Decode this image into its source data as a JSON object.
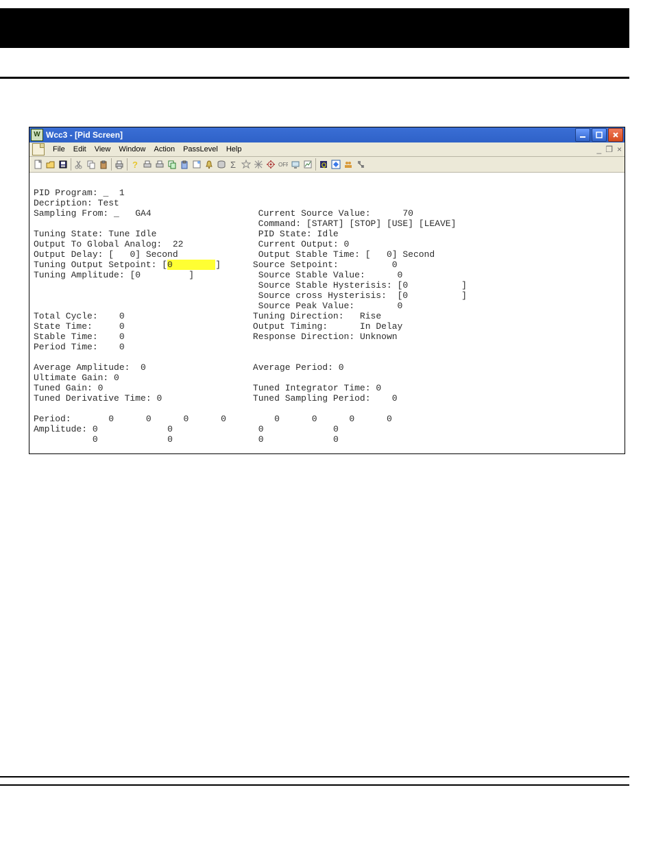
{
  "window": {
    "app_icon_text": "W",
    "title": "Wcc3 - [Pid Screen]"
  },
  "menu": {
    "items": [
      "File",
      "Edit",
      "View",
      "Window",
      "Action",
      "PassLevel",
      "Help"
    ]
  },
  "left": {
    "pid_program_label": "PID Program:",
    "pid_program_value": "_  1",
    "description_label": "Decription:",
    "description_value": "Test",
    "sampling_from_label": "Sampling From:",
    "sampling_from_value": "_   GA4",
    "tuning_state_label": "Tuning State:",
    "tuning_state_value": "Tune Idle",
    "output_global_label": "Output To Global Analog:",
    "output_global_value": "22",
    "output_delay_label": "Output Delay:",
    "output_delay_value": "[   0] Second",
    "tuning_output_setpoint_label": "Tuning Output Setpoint:",
    "tuning_output_setpoint_value": "0",
    "tuning_amplitude_label": "Tuning Amplitude:",
    "tuning_amplitude_value": "[0         ]",
    "total_cycle_label": "Total Cycle:",
    "total_cycle_value": "0",
    "state_time_label": "State Time:",
    "state_time_value": "0",
    "stable_time_label": "Stable Time:",
    "stable_time_value": "0",
    "period_time_label": "Period Time:",
    "period_time_value": "0",
    "avg_amplitude_label": "Average Amplitude:",
    "avg_amplitude_value": "0",
    "ultimate_gain_label": "Ultimate Gain:",
    "ultimate_gain_value": "0",
    "tuned_gain_label": "Tuned Gain:",
    "tuned_gain_value": "0",
    "tuned_derivative_label": "Tuned Derivative Time:",
    "tuned_derivative_value": "0",
    "period_row_label": "Period:",
    "period_row": [
      "0",
      "0",
      "0",
      "0"
    ],
    "amplitude_row_label": "Amplitude:",
    "amplitude_row1": [
      "0",
      "0"
    ],
    "amplitude_row2": [
      "0",
      "0"
    ]
  },
  "right": {
    "current_source_label": "Current Source Value:",
    "current_source_value": "70",
    "command_label": "Command:",
    "command_buttons": [
      "[START]",
      "[STOP]",
      "[USE]",
      "[LEAVE]"
    ],
    "pid_state_label": "PID State:",
    "pid_state_value": "Idle",
    "current_output_label": "Current Output:",
    "current_output_value": "0",
    "output_stable_time_label": "Output Stable Time:",
    "output_stable_time_value": "[   0] Second",
    "source_setpoint_label": "Source Setpoint:",
    "source_setpoint_value": "0",
    "source_stable_value_label": "Source Stable Value:",
    "source_stable_value": "0",
    "source_stable_hyst_label": "Source Stable Hysterisis:",
    "source_stable_hyst_value": "[0          ]",
    "source_cross_hyst_label": "Source cross Hysterisis:",
    "source_cross_hyst_value": "[0          ]",
    "source_peak_label": "Source Peak Value:",
    "source_peak_value": "0",
    "tuning_direction_label": "Tuning Direction:",
    "tuning_direction_value": "Rise",
    "output_timing_label": "Output Timing:",
    "output_timing_value": "In Delay",
    "response_direction_label": "Response Direction:",
    "response_direction_value": "Unknown",
    "avg_period_label": "Average Period:",
    "avg_period_value": "0",
    "tuned_integrator_label": "Tuned Integrator Time:",
    "tuned_integrator_value": "0",
    "tuned_sampling_label": "Tuned Sampling Period:",
    "tuned_sampling_value": "0",
    "period_row": [
      "0",
      "0",
      "0",
      "0"
    ],
    "amplitude_row1": [
      "0",
      "0"
    ],
    "amplitude_row2": [
      "0",
      "0"
    ]
  }
}
